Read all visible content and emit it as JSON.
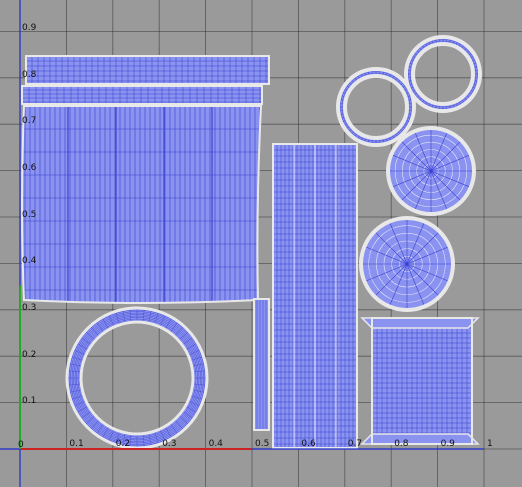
{
  "editor": {
    "title": "",
    "u_axis_color": "#cc2222",
    "v_axis_color": "#22aa22",
    "grid_color": "#222222",
    "background": "#9a9a9a",
    "shell_fill": "#8a93f0",
    "wire_dense": "#3a3fcf",
    "wire_edge": "#e8e8e8"
  },
  "axes": {
    "origin_label": "0",
    "u_ticks": [
      {
        "value": 0.1,
        "label": "0.1"
      },
      {
        "value": 0.2,
        "label": "0.2"
      },
      {
        "value": 0.3,
        "label": "0.3"
      },
      {
        "value": 0.4,
        "label": "0.4"
      },
      {
        "value": 0.5,
        "label": "0.5"
      },
      {
        "value": 0.6,
        "label": "0.6"
      },
      {
        "value": 0.7,
        "label": "0.7"
      },
      {
        "value": 0.8,
        "label": "0.8"
      },
      {
        "value": 0.9,
        "label": "0.9"
      },
      {
        "value": 1.0,
        "label": "1"
      }
    ],
    "v_ticks": [
      {
        "value": 0.1,
        "label": "0.1"
      },
      {
        "value": 0.2,
        "label": "0.2"
      },
      {
        "value": 0.3,
        "label": "0.3"
      },
      {
        "value": 0.4,
        "label": "0.4"
      },
      {
        "value": 0.5,
        "label": "0.5"
      },
      {
        "value": 0.6,
        "label": "0.6"
      },
      {
        "value": 0.7,
        "label": "0.7"
      },
      {
        "value": 0.8,
        "label": "0.8"
      },
      {
        "value": 0.9,
        "label": "0.9"
      }
    ]
  },
  "uv_islands": [
    {
      "name": "uv-island-body-panel",
      "kind": "panel"
    },
    {
      "name": "uv-island-rim-strip",
      "kind": "strip"
    },
    {
      "name": "uv-island-band-strip",
      "kind": "strip"
    },
    {
      "name": "uv-island-ring-large",
      "kind": "ring"
    },
    {
      "name": "uv-island-side-strip",
      "kind": "strip"
    },
    {
      "name": "uv-island-tall-column",
      "kind": "column"
    },
    {
      "name": "uv-island-ring-small-left",
      "kind": "ring"
    },
    {
      "name": "uv-island-ring-small-right",
      "kind": "ring"
    },
    {
      "name": "uv-island-cap-disc-top",
      "kind": "disc"
    },
    {
      "name": "uv-island-cap-disc-bottom",
      "kind": "disc"
    },
    {
      "name": "uv-island-spool-block",
      "kind": "block"
    }
  ]
}
